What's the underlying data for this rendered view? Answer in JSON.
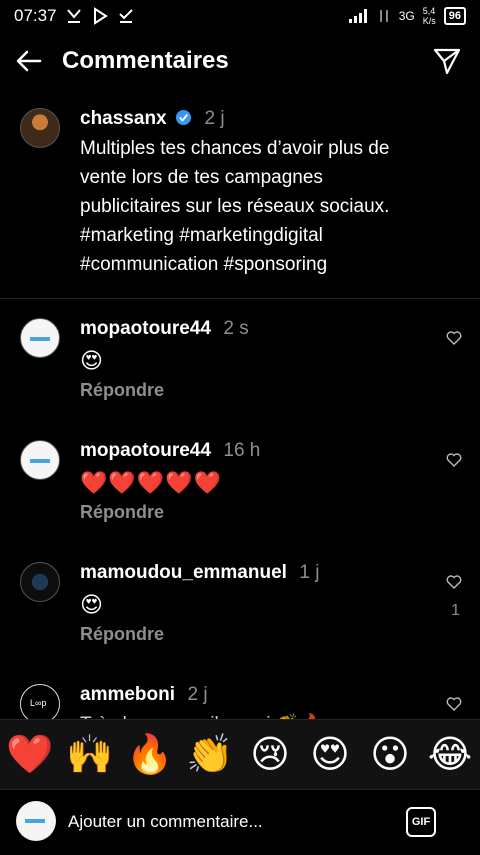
{
  "status_bar": {
    "time": "07:37",
    "network": "3G",
    "speed": "5,4",
    "speed_unit": "K/s",
    "battery": "96"
  },
  "header": {
    "title": "Commentaires"
  },
  "post": {
    "username": "chassanx",
    "time": "2 j",
    "verified": true,
    "lines": [
      "Multiples tes chances d’avoir plus de",
      "vente lors de tes campagnes",
      "publicitaires sur les réseaux sociaux.",
      "#marketing #marketingdigital",
      "#communication #sponsoring"
    ]
  },
  "comments": [
    {
      "username": "mopaotoure44",
      "time": "2 s",
      "content": "😍",
      "reply": "Répondre",
      "likes": ""
    },
    {
      "username": "mopaotoure44",
      "time": "16 h",
      "content": "❤️❤️❤️❤️❤️",
      "reply": "Répondre",
      "likes": ""
    },
    {
      "username": "mamoudou_emmanuel",
      "time": "1 j",
      "content": "😍",
      "reply": "Répondre",
      "likes": "1"
    },
    {
      "username": "ammeboni",
      "time": "2 j",
      "content": "Très bon conseil merci 👏🔥",
      "reply": "",
      "likes": ""
    }
  ],
  "reactions": [
    "❤️",
    "🙌",
    "🔥",
    "👏",
    "😢",
    "😍",
    "😮",
    "😂"
  ],
  "composer": {
    "placeholder": "Ajouter un commentaire...",
    "gif_label": "GIF"
  },
  "colors": {
    "background": "#000000",
    "secondary_text": "#8e8e8e",
    "verified_blue": "#3897f0",
    "reaction_bar": "#121212"
  }
}
